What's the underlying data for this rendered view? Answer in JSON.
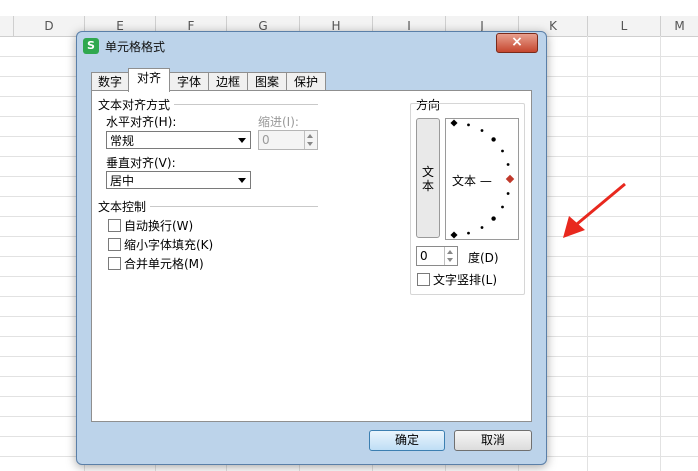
{
  "spreadsheet": {
    "columns": [
      "D",
      "E",
      "F",
      "G",
      "H",
      "I",
      "J",
      "K",
      "L",
      "M"
    ]
  },
  "dialog": {
    "title": "单元格格式",
    "app_icon_letter": "S",
    "close_glyph": "×",
    "tabs": [
      "数字",
      "对齐",
      "字体",
      "边框",
      "图案",
      "保护"
    ],
    "active_tab": "对齐",
    "text_alignment": {
      "title": "文本对齐方式",
      "horizontal_label": "水平对齐(H):",
      "horizontal_value": "常规",
      "indent_label": "缩进(I):",
      "indent_value": "0",
      "vertical_label": "垂直对齐(V):",
      "vertical_value": "居中"
    },
    "text_control": {
      "title": "文本控制",
      "wrap_text": "自动换行(W)",
      "shrink_to_fit": "缩小字体填充(K)",
      "merge_cells": "合并单元格(M)"
    },
    "orientation": {
      "title": "方向",
      "vertical_text": "文本",
      "dial_text": "文本 —",
      "degrees_value": "0",
      "degrees_label": "度(D)",
      "vertical_stack_label": "文字竖排(L)"
    },
    "ok_label": "确定",
    "cancel_label": "取消"
  },
  "colors": {
    "annotation_arrow": "#e8281e",
    "dialog_frame": "#bcd3ea"
  }
}
